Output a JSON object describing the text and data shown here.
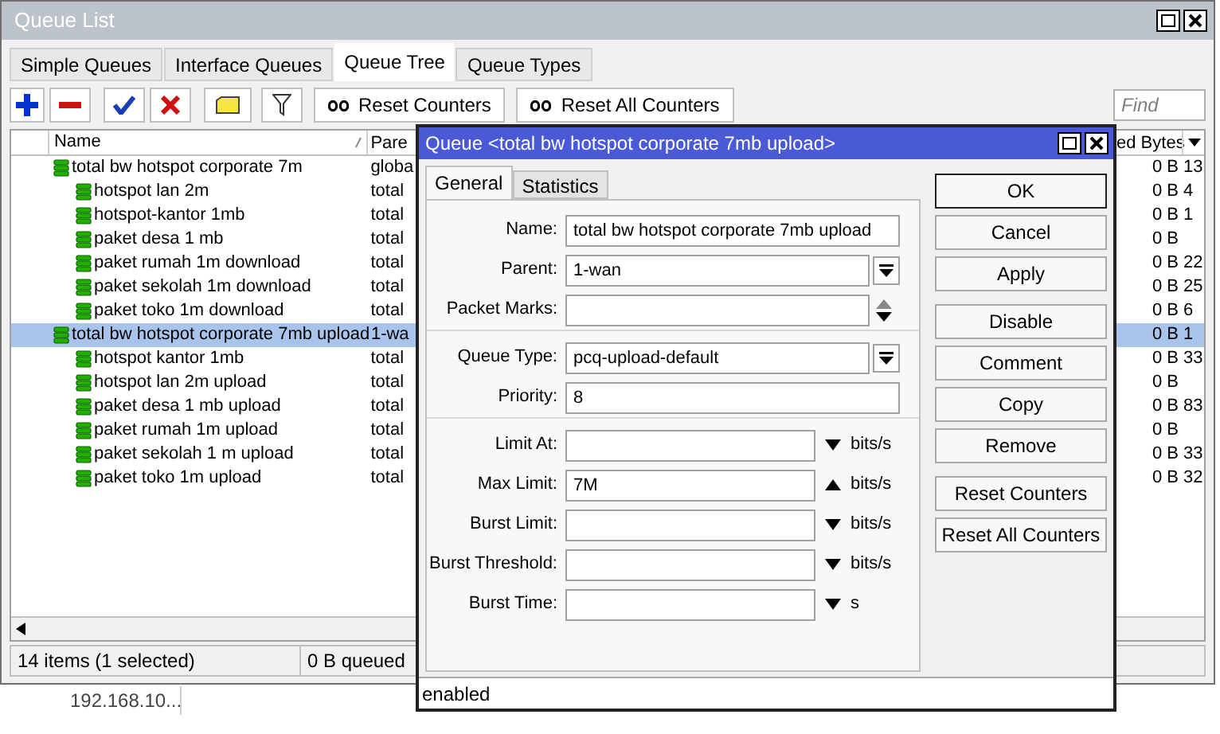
{
  "queue_list": {
    "title": "Queue List",
    "tabs": [
      {
        "label": "Simple Queues",
        "selected": false
      },
      {
        "label": "Interface Queues",
        "selected": false
      },
      {
        "label": "Queue Tree",
        "selected": true
      },
      {
        "label": "Queue Types",
        "selected": false
      }
    ],
    "toolbar": {
      "buttons": [
        "Reset Counters",
        "Reset All Counters"
      ]
    },
    "search": {
      "placeholder": "Find"
    },
    "table": {
      "columns": [
        "Name",
        "Pare",
        "ed Bytes"
      ],
      "rows": [
        {
          "name": "total bw hotspot corporate 7m",
          "parent": "globa",
          "column_3": "0 B",
          "column_4": "13",
          "selected": false,
          "children": [
            {
              "name": "hotspot lan 2m",
              "parent": "total",
              "column_3": "0 B",
              "column_4": "4",
              "selected": false
            },
            {
              "name": "hotspot-kantor 1mb",
              "parent": "total",
              "column_3": "0 B",
              "column_4": "1",
              "selected": false
            },
            {
              "name": "paket desa 1 mb",
              "parent": "total",
              "column_3": "0 B",
              "selected": false
            },
            {
              "name": "paket rumah 1m download",
              "parent": "total",
              "column_3": "0 B",
              "column_4": "22",
              "selected": false
            },
            {
              "name": "paket sekolah 1m download",
              "parent": "total",
              "column_3": "0 B",
              "column_4": "25",
              "selected": false
            },
            {
              "name": "paket toko 1m download",
              "parent": "total",
              "column_3": "0 B",
              "column_4": "6",
              "selected": false
            }
          ]
        },
        {
          "name": "total bw hotspot corporate 7mb upload",
          "parent": "1-wa",
          "column_3": "0 B",
          "column_4": "1",
          "selected": true,
          "children": [
            {
              "name": "hotspot kantor 1mb",
              "parent": "total",
              "column_3": "0 B",
              "column_4": "33",
              "selected": false
            },
            {
              "name": "hotspot lan 2m upload",
              "parent": "total",
              "column_3": "0 B",
              "selected": false
            },
            {
              "name": "paket desa 1 mb upload",
              "parent": "total",
              "column_3": "0 B",
              "column_4": "83",
              "selected": false
            },
            {
              "name": "paket rumah 1m upload",
              "parent": "total",
              "column_3": "0 B",
              "selected": false
            },
            {
              "name": "paket sekolah 1 m upload",
              "parent": "total",
              "column_3": "0 B",
              "column_4": "33",
              "selected": false
            },
            {
              "name": "paket toko 1m upload",
              "parent": "total",
              "column_3": "0 B",
              "column_4": "32",
              "selected": false
            }
          ]
        }
      ]
    },
    "status_bar": [
      "14 items (1 selected)",
      "0 B queued"
    ]
  },
  "background_text": "192.168.10...",
  "dialog": {
    "title": "Queue <total bw hotspot corporate 7mb upload>",
    "tabs": [
      {
        "label": "General",
        "selected": true
      },
      {
        "label": "Statistics",
        "selected": false
      }
    ],
    "groups": [
      [
        {
          "kind": "text",
          "label": "Name:",
          "value": "total bw hotspot corporate 7mb upload"
        },
        {
          "kind": "select",
          "label": "Parent:",
          "value": "1-wan"
        },
        {
          "kind": "updown",
          "label": "Packet Marks:"
        }
      ],
      [
        {
          "kind": "select",
          "label": "Queue Type:",
          "value": "pcq-upload-default"
        },
        {
          "kind": "text",
          "label": "Priority:",
          "value": "8"
        }
      ],
      [
        {
          "kind": "limit",
          "label": "Limit At:",
          "expanded": false,
          "unit": "bits/s"
        },
        {
          "kind": "limit",
          "label": "Max Limit:",
          "value": "7M",
          "expanded": true,
          "unit": "bits/s"
        },
        {
          "kind": "limit",
          "label": "Burst Limit:",
          "expanded": false,
          "unit": "bits/s"
        },
        {
          "kind": "limit",
          "label": "Burst Threshold:",
          "expanded": false,
          "unit": "bits/s"
        },
        {
          "kind": "limit",
          "label": "Burst Time:",
          "expanded": false,
          "unit": "s"
        }
      ]
    ],
    "button_groups": [
      [
        "OK",
        "Cancel",
        "Apply"
      ],
      [
        "Disable",
        "Comment",
        "Copy",
        "Remove"
      ],
      [
        "Reset Counters",
        "Reset All Counters"
      ]
    ],
    "status": "enabled"
  }
}
